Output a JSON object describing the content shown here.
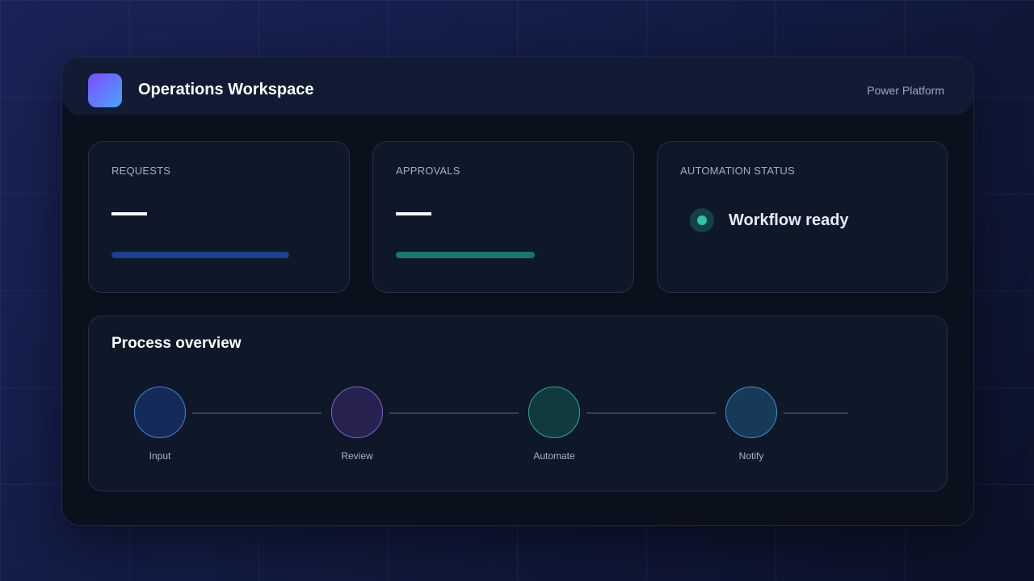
{
  "header": {
    "title": "Operations Workspace",
    "platform": "Power Platform",
    "logo_icon": "app-logo-icon"
  },
  "cards": {
    "requests": {
      "label": "REQUESTS",
      "bar_color": "#1e3f91",
      "progress": 0.55
    },
    "approvals": {
      "label": "APPROVALS",
      "bar_color": "#17776e",
      "progress": 0.43
    },
    "automation": {
      "label": "AUTOMATION STATUS",
      "status": "Workflow ready",
      "status_color": "#2cc5a6"
    }
  },
  "process": {
    "title": "Process overview",
    "steps": [
      {
        "label": "Input",
        "fill": "#152a5a",
        "stroke": "#3f86d8"
      },
      {
        "label": "Review",
        "fill": "#27214f",
        "stroke": "#7a63c9"
      },
      {
        "label": "Automate",
        "fill": "#0f3b3e",
        "stroke": "#2ea88f"
      },
      {
        "label": "Notify",
        "fill": "#173a58",
        "stroke": "#3a8fc9"
      }
    ]
  }
}
